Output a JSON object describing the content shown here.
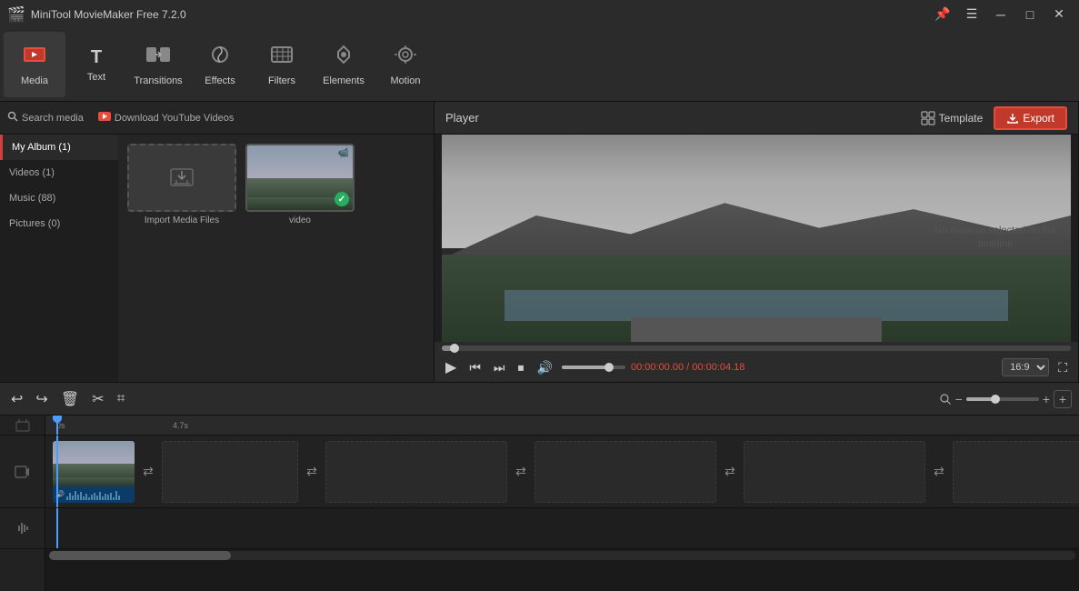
{
  "titlebar": {
    "title": "MiniTool MovieMaker Free 7.2.0",
    "icon": "🎬"
  },
  "toolbar": {
    "items": [
      {
        "label": "Media",
        "icon": "🗂",
        "active": true
      },
      {
        "label": "Text",
        "icon": "T"
      },
      {
        "label": "Transitions",
        "icon": "⇄"
      },
      {
        "label": "Effects",
        "icon": "✦"
      },
      {
        "label": "Filters",
        "icon": "▦"
      },
      {
        "label": "Elements",
        "icon": "⬡"
      },
      {
        "label": "Motion",
        "icon": "◎"
      }
    ]
  },
  "left_panel": {
    "album_items": [
      {
        "label": "My Album (1)",
        "active": true
      },
      {
        "label": "Videos (1)"
      },
      {
        "label": "Music (88)"
      },
      {
        "label": "Pictures (0)"
      }
    ],
    "search_placeholder": "Search media",
    "download_label": "Download YouTube Videos",
    "import_label": "Import Media Files",
    "video_label": "video"
  },
  "player": {
    "title": "Player",
    "template_label": "Template",
    "export_label": "Export",
    "time_current": "00:00:00.00",
    "time_total": "00:00:04.18",
    "aspect_ratio": "16:9",
    "no_material": "No material selected on the timeline"
  },
  "timeline": {
    "ruler_marks": [
      "0s",
      "4.7s"
    ],
    "add_button": "+",
    "zoom_minus": "−",
    "zoom_plus": "+"
  },
  "colors": {
    "accent_red": "#c0392b",
    "border_red": "#e74c3c",
    "playhead_blue": "#4a9eff"
  }
}
